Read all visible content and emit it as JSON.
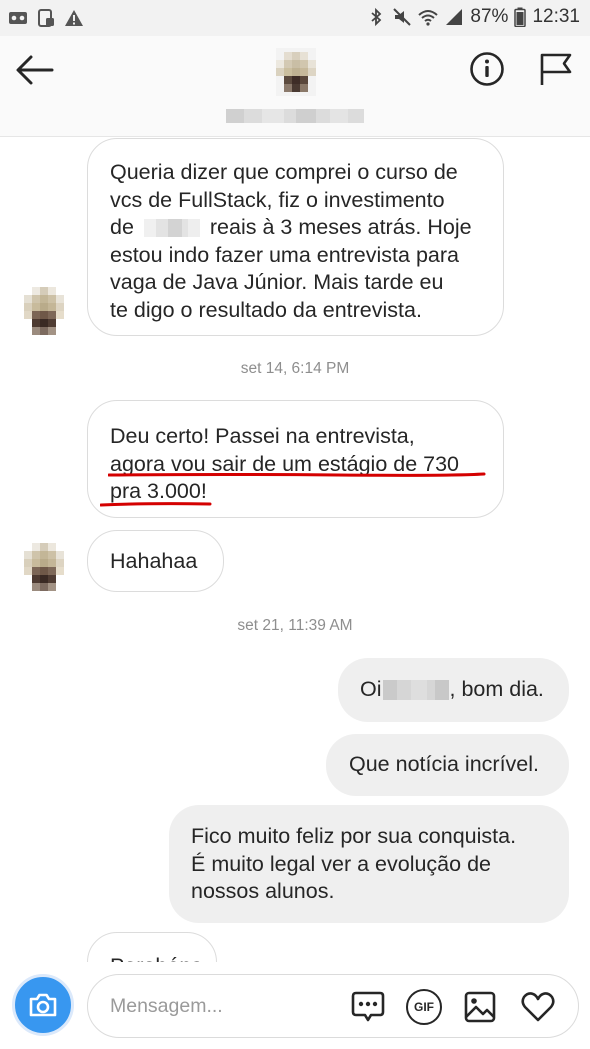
{
  "status_bar": {
    "battery": "87%",
    "time": "12:31",
    "left_icons": [
      "voicemail-icon",
      "screen-lock-icon",
      "warning-icon"
    ],
    "right_icons": [
      "bluetooth-icon",
      "mute-icon",
      "wifi-icon",
      "signal-icon",
      "battery-icon"
    ]
  },
  "header": {
    "back_icon": "arrow-left-icon",
    "info_icon": "info-icon",
    "flag_icon": "flag-icon"
  },
  "messages": {
    "m1": "Queria dizer que comprei o curso de",
    "m1_l2": "vcs de FullStack, fiz o investimento",
    "m1_l3a": "de",
    "m1_l3b": "reais à 3 meses atrás. Hoje",
    "m1_l4": "estou indo fazer uma entrevista para",
    "m1_l5": "vaga de Java Júnior. Mais tarde eu",
    "m1_l6": "te digo o resultado da entrevista.",
    "ts1": "set 14, 6:14 PM",
    "m2_l1": "Deu certo! Passei na entrevista,",
    "m2_l2": "agora vou sair de um estágio de 730",
    "m2_l3a": "pra 3.000",
    "m2_l3b": "!",
    "m3": "Hahahaa",
    "ts2": "set 21, 11:39 AM",
    "m4a": "Oi",
    "m4b": ", bom dia.",
    "m5": "Que notícia incrível.",
    "m6_l1": "Fico muito feliz por sua conquista.",
    "m6_l2": "É muito legal ver a evolução de",
    "m6_l3": "nossos alunos.",
    "m7_partial": "Parabéns"
  },
  "composer": {
    "placeholder": "Mensagem...",
    "camera_icon": "camera-icon",
    "icons": [
      "chat-dots-icon",
      "gif-icon",
      "image-icon",
      "heart-icon"
    ],
    "gif_label": "GIF"
  },
  "colors": {
    "accent": "#3897f0",
    "underline": "#d40000",
    "outgoing_bubble": "#efefef",
    "timestamp": "#8e8e8e"
  }
}
